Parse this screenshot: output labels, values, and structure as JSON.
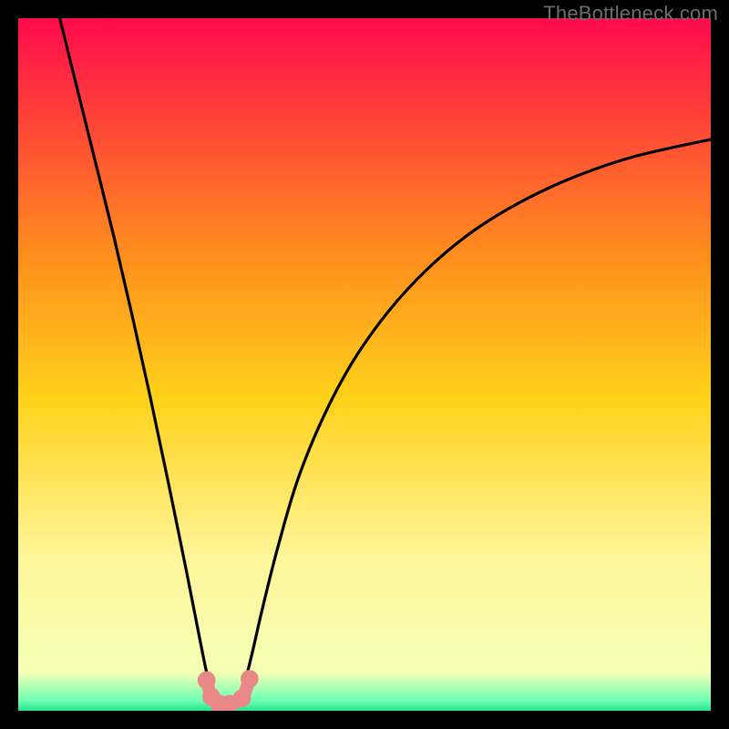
{
  "watermark": {
    "text": "TheBottleneck.com"
  },
  "chart_data": {
    "type": "line",
    "title": "",
    "xlabel": "",
    "ylabel": "",
    "xlim": [
      0,
      100
    ],
    "ylim": [
      0,
      100
    ],
    "grid": false,
    "legend": false,
    "background_gradient": {
      "stops": [
        {
          "offset": 0.0,
          "color": "#ff0a4c"
        },
        {
          "offset": 0.33,
          "color": "#ff8a1f"
        },
        {
          "offset": 0.55,
          "color": "#ffd21a"
        },
        {
          "offset": 0.78,
          "color": "#fff69a"
        },
        {
          "offset": 0.945,
          "color": "#f4ffb4"
        },
        {
          "offset": 0.985,
          "color": "#6dffb4"
        },
        {
          "offset": 1.0,
          "color": "#28e38b"
        }
      ]
    },
    "series": [
      {
        "name": "left-branch",
        "x": [
          6.0,
          8.6,
          11.2,
          13.8,
          16.4,
          19.0,
          21.6,
          24.2,
          25.5,
          27.1,
          28.0,
          29.0,
          30.8
        ],
        "y": [
          100.0,
          89.5,
          79.0,
          68.5,
          57.3,
          45.6,
          33.3,
          20.6,
          14.0,
          6.0,
          2.5,
          1.0,
          1.0
        ]
      },
      {
        "name": "right-branch",
        "x": [
          30.8,
          32.3,
          33.7,
          35.2,
          37.4,
          40.3,
          44.0,
          48.3,
          53.4,
          59.1,
          65.6,
          72.8,
          80.6,
          89.2,
          100.0
        ],
        "y": [
          1.0,
          2.8,
          8.0,
          14.5,
          23.3,
          33.2,
          42.3,
          50.4,
          57.6,
          63.8,
          69.2,
          73.6,
          77.2,
          80.1,
          82.5
        ]
      }
    ],
    "bottom_markers": {
      "color": "#e98886",
      "points": [
        {
          "x": 27.2,
          "y": 4.4,
          "r": 1.3
        },
        {
          "x": 27.9,
          "y": 2.0,
          "r": 1.3
        },
        {
          "x": 29.0,
          "y": 1.0,
          "r": 1.3
        },
        {
          "x": 30.5,
          "y": 1.0,
          "r": 1.3
        },
        {
          "x": 32.3,
          "y": 1.8,
          "r": 1.3
        },
        {
          "x": 33.4,
          "y": 4.6,
          "r": 1.3
        }
      ],
      "connector": [
        {
          "x": 27.2,
          "y": 4.4
        },
        {
          "x": 27.9,
          "y": 2.0
        },
        {
          "x": 29.0,
          "y": 1.0
        },
        {
          "x": 30.5,
          "y": 1.0
        },
        {
          "x": 32.3,
          "y": 1.8
        },
        {
          "x": 33.4,
          "y": 4.6
        }
      ]
    }
  }
}
